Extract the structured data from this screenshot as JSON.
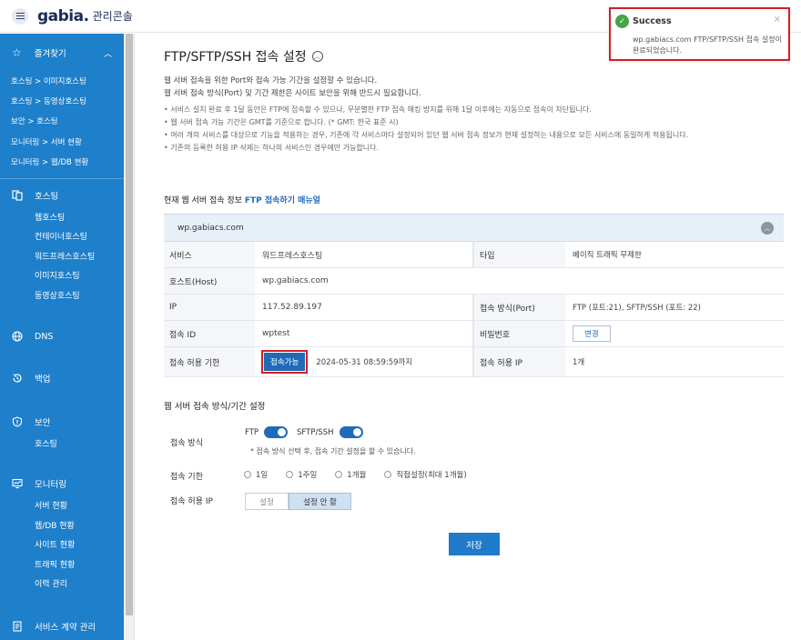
{
  "header": {
    "logo": "gabia",
    "console_title": "관리콘솔"
  },
  "sidebar": {
    "favorites_label": "즐겨찾기",
    "favorites": [
      "호스팅 > 이미지호스팅",
      "호스팅 > 동영상호스팅",
      "보안 > 호스팅",
      "모니터링 > 서버 현황",
      "모니터링 > 웹/DB 현황"
    ],
    "hosting": {
      "label": "호스팅",
      "items": [
        "웹호스팅",
        "컨테이너호스팅",
        "워드프레스호스팅",
        "이미지호스팅",
        "동영상호스팅"
      ]
    },
    "dns": {
      "label": "DNS"
    },
    "backup": {
      "label": "백업"
    },
    "security": {
      "label": "보안",
      "items": [
        "호스팅"
      ]
    },
    "monitoring": {
      "label": "모니터링",
      "items": [
        "서버 현황",
        "웹/DB 현황",
        "사이트 현황",
        "트래픽 현황",
        "이력 관리"
      ]
    },
    "contract": {
      "label": "서비스 계약 관리"
    }
  },
  "page": {
    "title": "FTP/SFTP/SSH 접속 설정",
    "desc1": "웹 서버 접속을 위한 Port와 접속 가능 기간을 설정할 수 있습니다.",
    "desc2": "웹 서버 접속 방식(Port) 및 기간 제한은 사이트 보안을 위해 반드시 필요합니다.",
    "bullets": [
      "•  서비스 설치 완료 후 1달 동안은 FTP에 접속할 수 있으나, 무분별한 FTP 접속 해킹 방지를 위해 1달 이후에는 자동으로 접속이 차단됩니다.",
      "•  웹 서버 접속 가능 기간은 GMT를 기준으로 합니다. (* GMT: 한국 표준 시)",
      "•  여러 개의 서비스를 대상으로 기능을 적용하는 경우, 기존에 각 서비스마다 설정되어 있던 웹 서버 접속 정보가 현재 설정하는 내용으로 모든 서비스에 동일하게 적용됩니다.",
      "•  기존의 등록한 허용 IP 삭제는 하나의 서비스인 경우에만 가능합니다."
    ]
  },
  "info": {
    "section_label": "현재 웹 서버 접속 정보",
    "manual_link": "FTP 접속하기 매뉴얼",
    "domain": "wp.gabiacs.com",
    "service_label": "서비스",
    "service_value": "워드프레스호스팅",
    "type_label": "타입",
    "type_value": "베이직 트래픽 무제한",
    "host_label": "호스트(Host)",
    "host_value": "wp.gabiacs.com",
    "ip_label": "IP",
    "ip_value": "117.52.89.197",
    "port_label": "접속 방식(Port)",
    "port_value": "FTP (포트:21), SFTP/SSH (포트: 22)",
    "id_label": "접속 ID",
    "id_value": "wptest",
    "pw_label": "비밀번호",
    "pw_button": "변경",
    "period_label": "접속 허용 기한",
    "period_button": "접속가능",
    "period_value": "2024-05-31 08:59:59까지",
    "allowed_ip_label": "접속 허용 IP",
    "allowed_ip_value": "1개"
  },
  "settings": {
    "title": "웹 서버 접속 방식/기간 설정",
    "method_label": "접속 방식",
    "ftp_label": "FTP",
    "ftp_on": true,
    "sftp_label": "SFTP/SSH",
    "sftp_on": true,
    "note": "* 접속 방식 선택 후, 접속 기간 설정을 할 수 있습니다.",
    "period_label": "접속 기한",
    "period_options": [
      "1일",
      "1주일",
      "1개월",
      "직접설정(최대 1개월)"
    ],
    "ip_label": "접속 허용 IP",
    "ip_options": [
      "설정",
      "설정 안 함"
    ],
    "ip_selected": "설정 안 함",
    "save_label": "저장"
  },
  "toast": {
    "title": "Success",
    "message": "wp.gabiacs.com FTP/SFTP/SSH 접속 설정이 완료되었습니다.",
    "close": "×"
  },
  "colors": {
    "sidebar": "#1e7fcb",
    "primary": "#1f6bb8",
    "highlight": "#d11f26",
    "success": "#47a447"
  }
}
